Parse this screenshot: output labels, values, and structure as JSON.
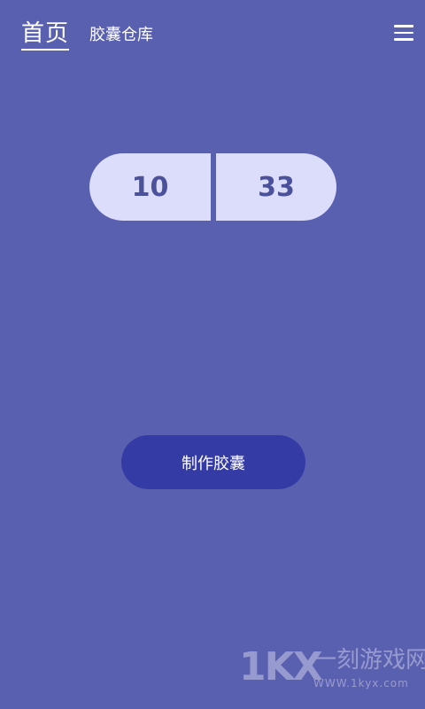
{
  "nav": {
    "tabs": [
      {
        "label": "首页",
        "active": true
      },
      {
        "label": "胶囊仓库",
        "active": false
      }
    ],
    "menu_icon": "hamburger-menu-icon"
  },
  "capsule": {
    "left_value": "10",
    "right_value": "33"
  },
  "actions": {
    "make_capsule_label": "制作胶囊"
  },
  "watermark": {
    "logo": "1KX",
    "text": "一刻游戏网",
    "url": "WWW.1kyx.com"
  },
  "colors": {
    "background": "#5a60b0",
    "capsule_fill": "#dcdcfb",
    "capsule_text": "#4b519b",
    "button": "#353ba5",
    "text": "#ffffff"
  }
}
